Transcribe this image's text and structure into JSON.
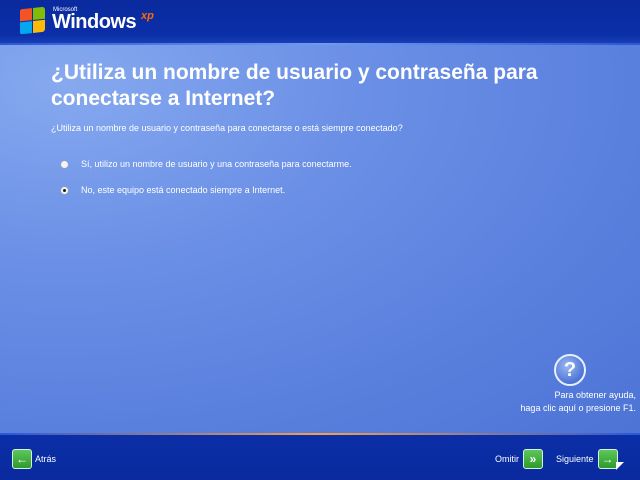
{
  "logo": {
    "microsoft": "Microsoft",
    "windows": "Windows",
    "xp": "xp"
  },
  "page": {
    "title": "¿Utiliza un nombre de usuario y contraseña para conectarse a Internet?",
    "question": "¿Utiliza un nombre de usuario y contraseña para conectarse o está siempre conectado?",
    "options": [
      {
        "label": "Sí, utilizo un nombre de usuario y una contraseña para conectarme.",
        "selected": false
      },
      {
        "label": "No, este equipo está conectado siempre a Internet.",
        "selected": true
      }
    ]
  },
  "help": {
    "line1": "Para obtener ayuda,",
    "line2": "haga clic aquí o presione F1."
  },
  "nav": {
    "back": "Atrás",
    "skip": "Omitir",
    "next": "Siguiente"
  }
}
